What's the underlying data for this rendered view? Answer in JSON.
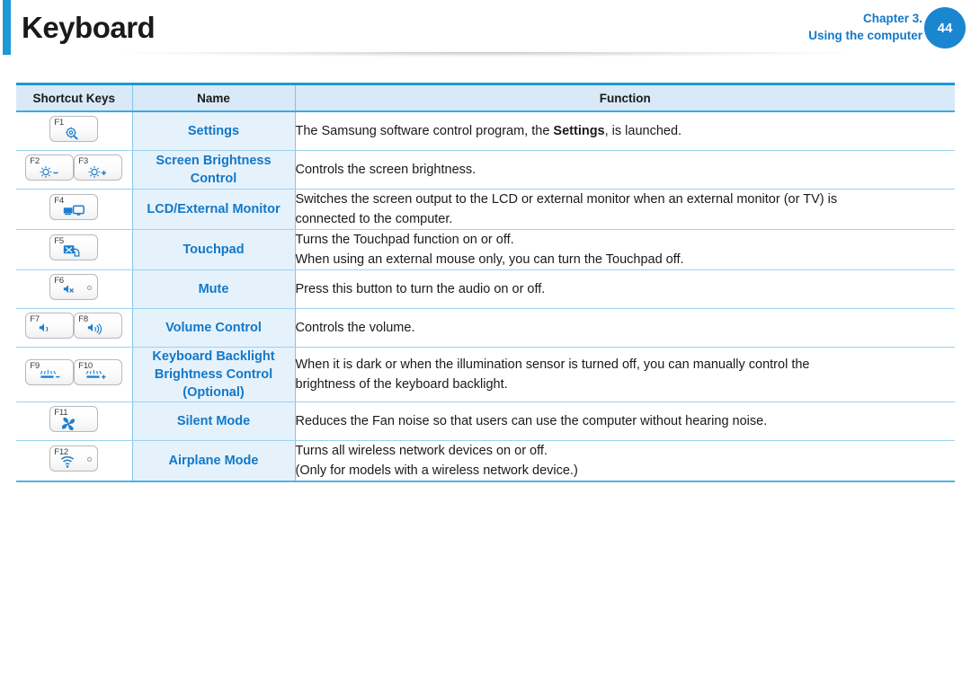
{
  "header": {
    "title": "Keyboard",
    "chapter_line1": "Chapter 3.",
    "chapter_line2": "Using the computer",
    "page_number": "44",
    "accent_color": "#1b9ad6",
    "link_color": "#1278c8"
  },
  "table": {
    "columns": [
      "Shortcut Keys",
      "Name",
      "Function"
    ],
    "rows": [
      {
        "keys": [
          {
            "label": "F1",
            "icon": "settings-gear-icon",
            "led": false
          }
        ],
        "name": "Settings",
        "function_lines": [
          [
            {
              "text": "The Samsung software control program, the ",
              "bold": false
            },
            {
              "text": "Settings",
              "bold": true
            },
            {
              "text": ", is launched.",
              "bold": false
            }
          ]
        ]
      },
      {
        "keys": [
          {
            "label": "F2",
            "icon": "brightness-down-icon",
            "led": false
          },
          {
            "label": "F3",
            "icon": "brightness-up-icon",
            "led": false
          }
        ],
        "name": "Screen Brightness Control",
        "function_lines": [
          [
            {
              "text": "Controls the screen brightness.",
              "bold": false
            }
          ]
        ]
      },
      {
        "keys": [
          {
            "label": "F4",
            "icon": "external-monitor-icon",
            "led": false
          }
        ],
        "name": "LCD/External Monitor",
        "function_lines": [
          [
            {
              "text": "Switches the screen output to the LCD or external monitor when an external monitor (or TV) is",
              "bold": false
            }
          ],
          [
            {
              "text": "connected to the computer.",
              "bold": false
            }
          ]
        ]
      },
      {
        "keys": [
          {
            "label": "F5",
            "icon": "touchpad-off-icon",
            "led": false
          }
        ],
        "name": "Touchpad",
        "function_lines": [
          [
            {
              "text": "Turns the Touchpad function on or off.",
              "bold": false
            }
          ],
          [
            {
              "text": "When using an external mouse only, you can turn the Touchpad off.",
              "bold": false
            }
          ]
        ]
      },
      {
        "keys": [
          {
            "label": "F6",
            "icon": "mute-icon",
            "led": true
          }
        ],
        "name": "Mute",
        "function_lines": [
          [
            {
              "text": "Press this button to turn the audio on or off.",
              "bold": false
            }
          ]
        ]
      },
      {
        "keys": [
          {
            "label": "F7",
            "icon": "volume-down-icon",
            "led": false
          },
          {
            "label": "F8",
            "icon": "volume-up-icon",
            "led": false
          }
        ],
        "name": "Volume Control",
        "function_lines": [
          [
            {
              "text": "Controls the volume.",
              "bold": false
            }
          ]
        ]
      },
      {
        "keys": [
          {
            "label": "F9",
            "icon": "keyboard-backlight-down-icon",
            "led": false
          },
          {
            "label": "F10",
            "icon": "keyboard-backlight-up-icon",
            "led": false
          }
        ],
        "name": "Keyboard Backlight Brightness Control (Optional)",
        "name_lines": [
          "Keyboard Backlight",
          "Brightness Control",
          "(Optional)"
        ],
        "function_lines": [
          [
            {
              "text": "When it is dark or when the illumination sensor is turned off, you can manually control the",
              "bold": false
            }
          ],
          [
            {
              "text": "brightness of the keyboard backlight.",
              "bold": false
            }
          ]
        ]
      },
      {
        "keys": [
          {
            "label": "F11",
            "icon": "fan-icon",
            "led": false
          }
        ],
        "name": "Silent Mode",
        "function_lines": [
          [
            {
              "text": "Reduces the Fan noise so that users can use the computer without hearing noise.",
              "bold": false
            }
          ]
        ]
      },
      {
        "keys": [
          {
            "label": "F12",
            "icon": "wireless-icon",
            "led": true
          }
        ],
        "name": "Airplane Mode",
        "function_lines": [
          [
            {
              "text": "Turns all wireless network devices on or off.",
              "bold": false
            }
          ],
          [
            {
              "text": "(Only for models with a wireless network device.)",
              "bold": false
            }
          ]
        ]
      }
    ]
  }
}
